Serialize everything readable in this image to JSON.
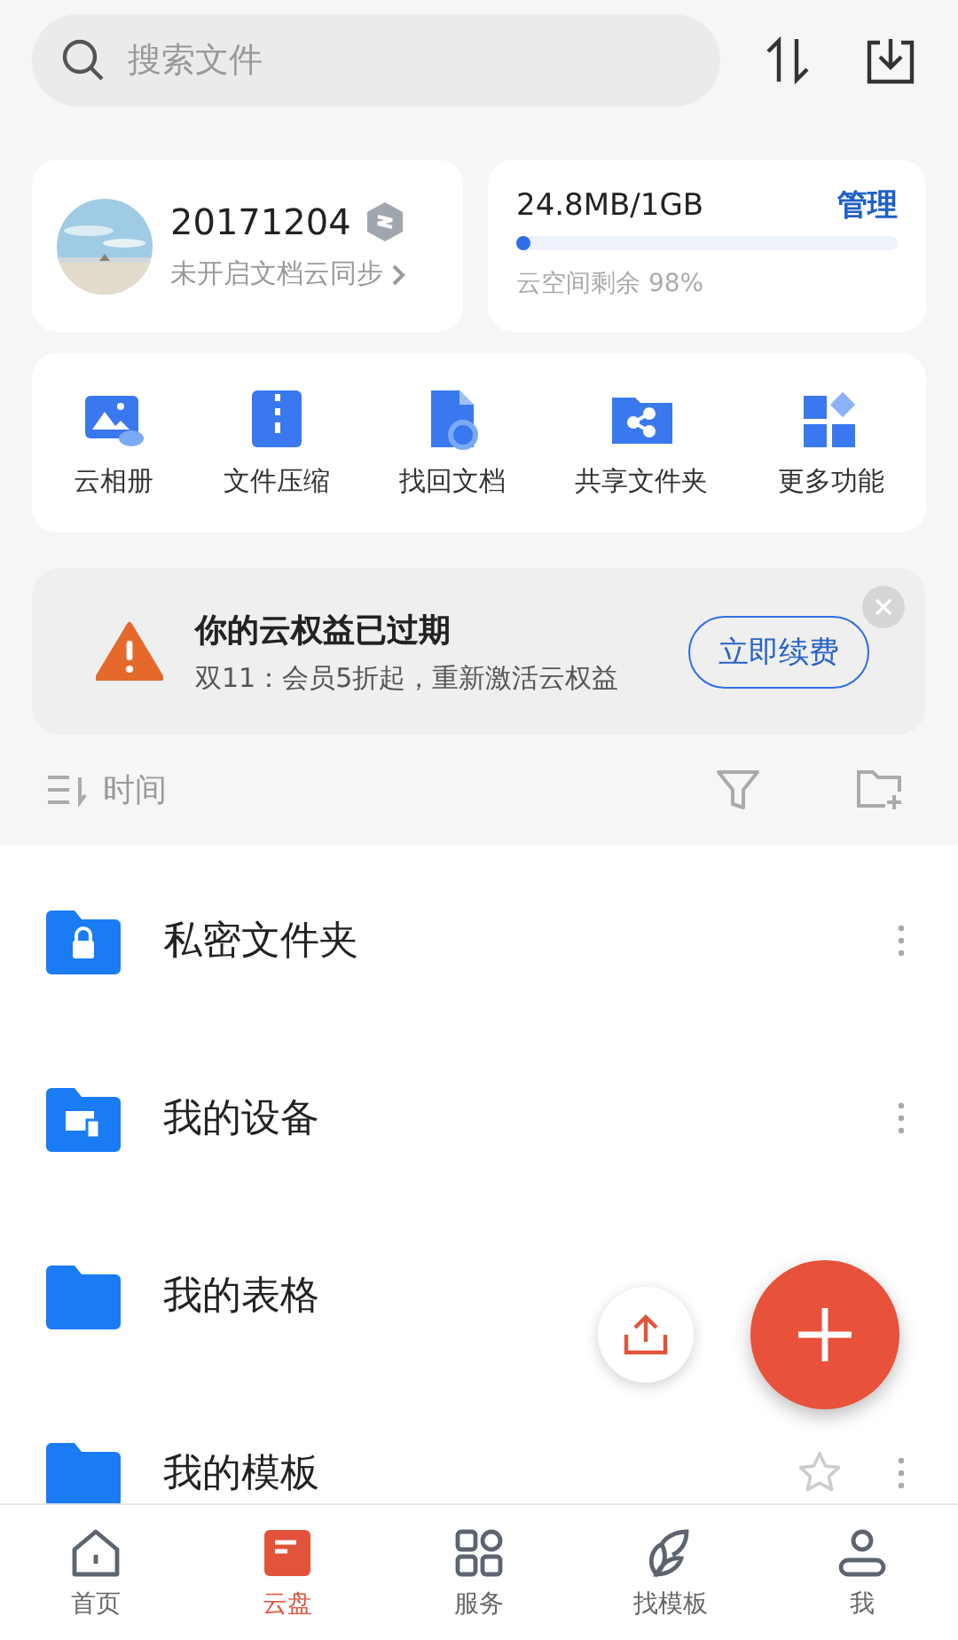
{
  "search": {
    "placeholder": "搜索文件"
  },
  "account": {
    "name": "20171204",
    "sync": "未开启文档云同步"
  },
  "storage": {
    "usage": "24.8MB/1GB",
    "manage": "管理",
    "level": 0.024,
    "remaining": "云空间剩余 98%"
  },
  "tools": [
    {
      "kind": "album",
      "label": "云相册"
    },
    {
      "kind": "zip",
      "label": "文件压缩"
    },
    {
      "kind": "recover",
      "label": "找回文档"
    },
    {
      "kind": "share",
      "label": "共享文件夹"
    },
    {
      "kind": "more",
      "label": "更多功能"
    }
  ],
  "banner": {
    "title": "你的云权益已过期",
    "text": "双11：会员5折起，重新激活云权益",
    "button": "立即续费"
  },
  "sort": {
    "label": "时间"
  },
  "files": [
    {
      "kind": "private",
      "name": "私密文件夹",
      "favorite_button": false,
      "menu": true
    },
    {
      "kind": "device",
      "name": "我的设备",
      "favorite_button": false,
      "menu": true
    },
    {
      "kind": "plain",
      "name": "我的表格"
    },
    {
      "kind": "plain",
      "name": "我的模板",
      "favorite_button": true,
      "menu": true
    }
  ],
  "nav": [
    {
      "kind": "home",
      "label": "首页",
      "selected": false
    },
    {
      "kind": "cloud",
      "label": "云盘",
      "selected": true
    },
    {
      "kind": "services",
      "label": "服务",
      "selected": false
    },
    {
      "kind": "templates",
      "label": "找模板",
      "selected": false
    },
    {
      "kind": "me",
      "label": "我",
      "selected": false
    }
  ]
}
